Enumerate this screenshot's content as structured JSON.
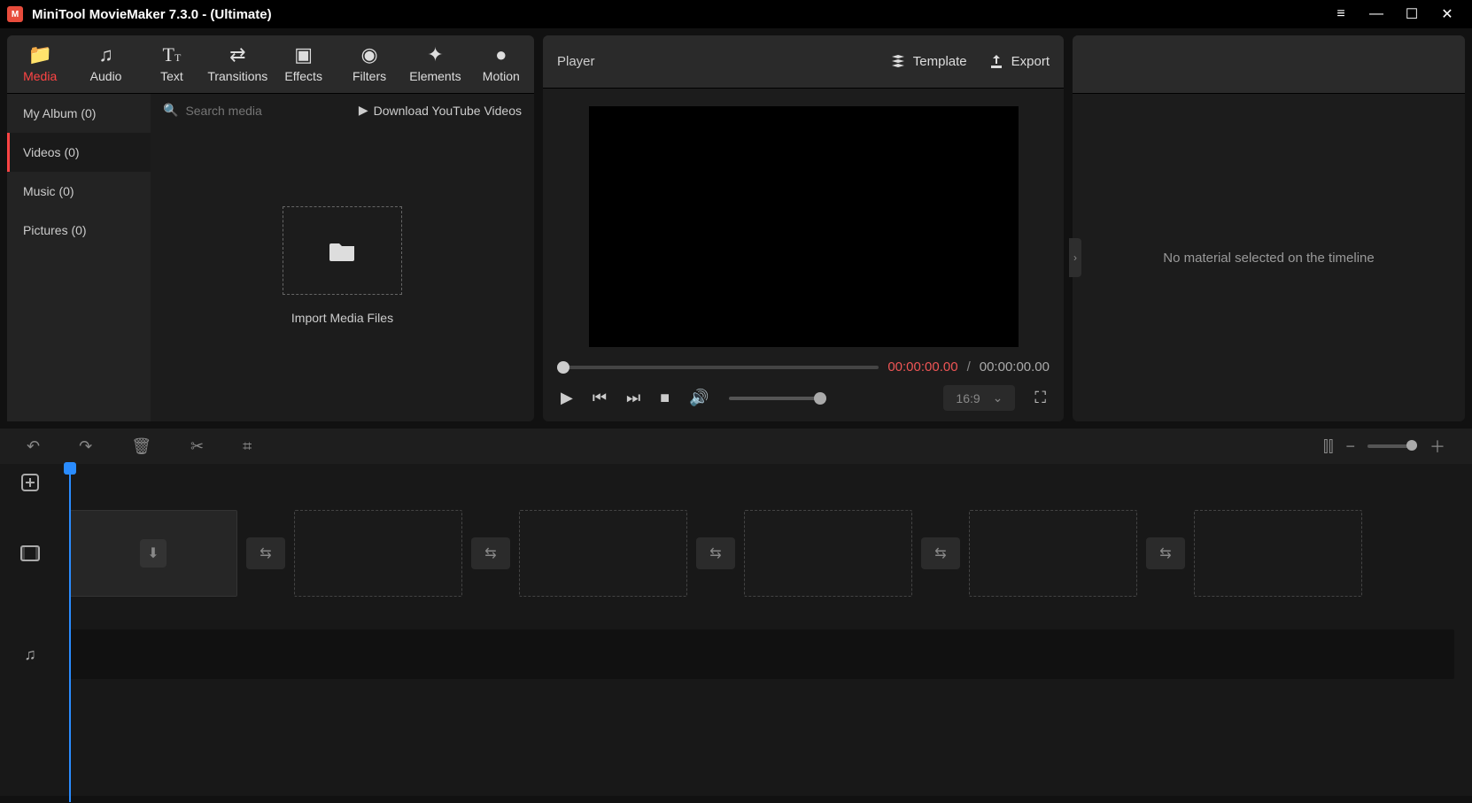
{
  "titlebar": {
    "title": "MiniTool MovieMaker 7.3.0 - (Ultimate)"
  },
  "tabs": {
    "media": "Media",
    "audio": "Audio",
    "text": "Text",
    "transitions": "Transitions",
    "effects": "Effects",
    "filters": "Filters",
    "elements": "Elements",
    "motion": "Motion"
  },
  "sidebar": {
    "myalbum": "My Album (0)",
    "videos": "Videos (0)",
    "music": "Music (0)",
    "pictures": "Pictures (0)"
  },
  "search": {
    "placeholder": "Search media"
  },
  "download_yt": "Download YouTube Videos",
  "import_label": "Import Media Files",
  "player": {
    "title": "Player",
    "template": "Template",
    "export": "Export",
    "time_current": "00:00:00.00",
    "time_sep": "/",
    "time_total": "00:00:00.00",
    "aspect": "16:9"
  },
  "props": {
    "empty": "No material selected on the timeline"
  }
}
